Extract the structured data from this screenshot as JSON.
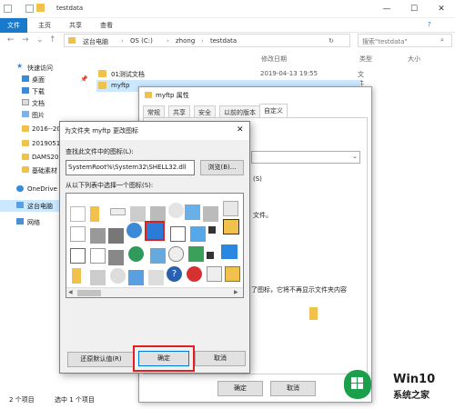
{
  "explorer": {
    "title": "testdata",
    "ribbon_tabs": [
      "文件",
      "主页",
      "共享",
      "查看"
    ],
    "breadcrumb": [
      "这台电脑",
      "OS (C:)",
      "zhong",
      "testdata"
    ],
    "search_placeholder": "搜索\"testdata\"",
    "columns": [
      "修改日期",
      "类型",
      "大小"
    ],
    "nav": [
      {
        "label": "快速访问",
        "icon": "star-icon"
      },
      {
        "label": "桌面",
        "icon": "desktop-icon"
      },
      {
        "label": "下载",
        "icon": "download-icon"
      },
      {
        "label": "文档",
        "icon": "document-icon"
      },
      {
        "label": "图片",
        "icon": "picture-icon"
      },
      {
        "label": "2016--20",
        "icon": "folder-icon"
      },
      {
        "label": "2019051",
        "icon": "folder-icon"
      },
      {
        "label": "DAMS20",
        "icon": "folder-icon"
      },
      {
        "label": "基础素材",
        "icon": "folder-icon"
      },
      {
        "label": "OneDrive",
        "icon": "cloud-icon"
      },
      {
        "label": "这台电脑",
        "icon": "computer-icon"
      },
      {
        "label": "网络",
        "icon": "network-icon"
      }
    ],
    "files": [
      {
        "name": "01测试文档",
        "date": "2019-04-13 19:55",
        "type": "文件夹"
      },
      {
        "name": "myftp",
        "date": "",
        "type": ""
      }
    ],
    "status": {
      "count": "2 个项目",
      "selected": "选中 1 个项目"
    }
  },
  "props": {
    "title": "myftp 属性",
    "tabs": [
      "常规",
      "共享",
      "安全",
      "以前的版本",
      "自定义"
    ],
    "text_s": "(S)",
    "text_file": "文件。",
    "text_icon_note": "了图标，它将不再显示文件夹内容",
    "ok": "确定",
    "cancel": "取消"
  },
  "icondlg": {
    "title": "为文件夹 myftp 更改图标",
    "find_label": "查找此文件中的图标(L):",
    "path": "SystemRoot%\\System32\\SHELL32.dll",
    "browse": "浏览(B)...",
    "pick_label": "从以下列表中选择一个图标(S):",
    "restore": "还原默认值(R)",
    "ok": "确定",
    "cancel": "取消"
  },
  "watermark": {
    "brand": "Win10",
    "sub": "系统之家"
  }
}
